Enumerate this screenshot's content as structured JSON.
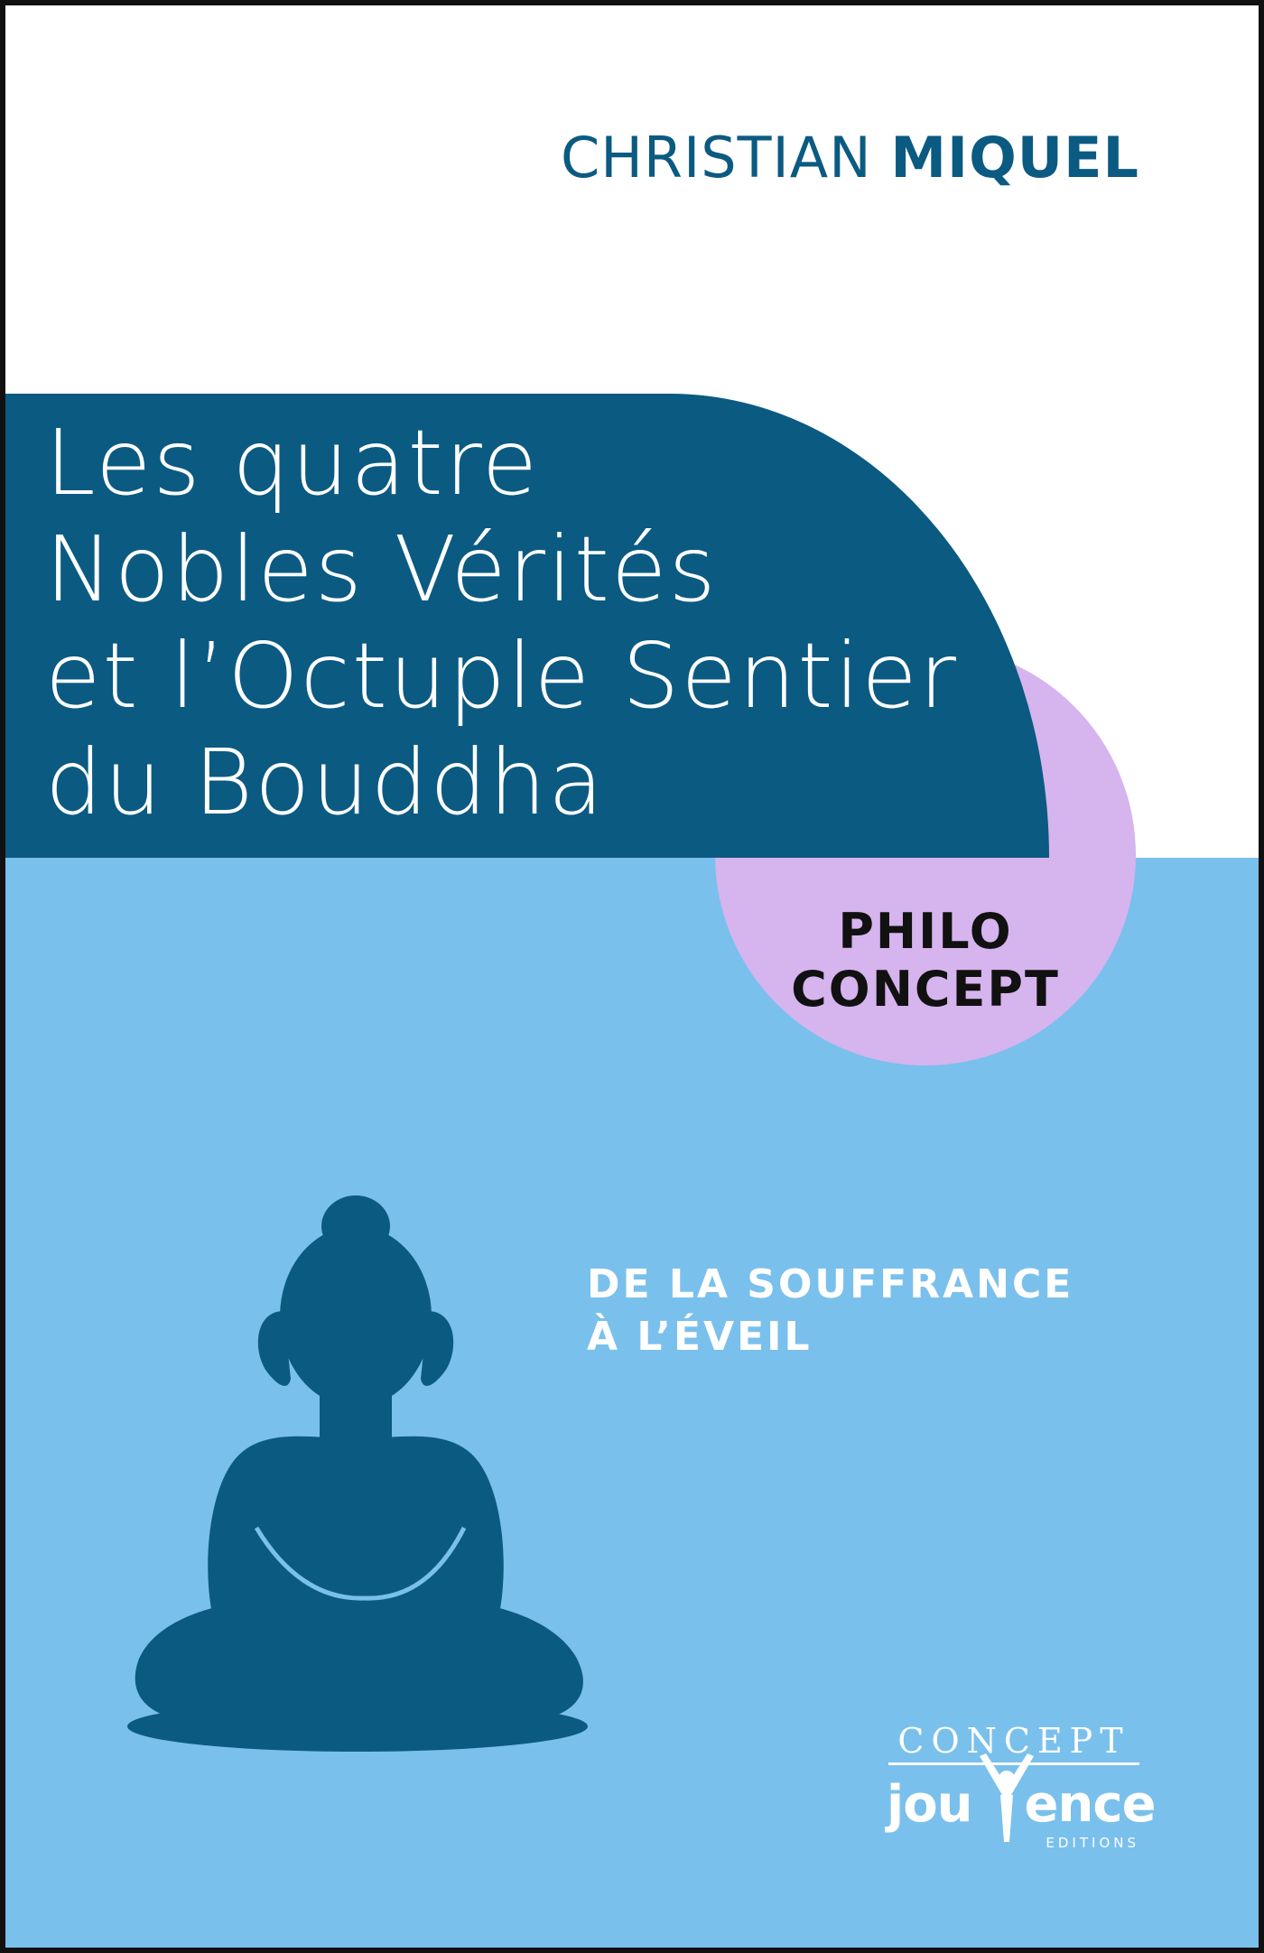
{
  "author": {
    "first_name": "CHRISTIAN",
    "last_name": "MIQUEL"
  },
  "title_lines": [
    "Les quatre",
    "Nobles Vérités",
    "et l’Octuple Sentier",
    "du Bouddha"
  ],
  "collection": {
    "line1": "PHILO",
    "line2": "CONCEPT"
  },
  "subtitle_lines": [
    "DE LA SOUFFRANCE",
    "À L’ÉVEIL"
  ],
  "publisher": {
    "series": "CONCEPT",
    "name_left": "jou",
    "name_right": "ence",
    "editions": "EDITIONS"
  },
  "illustration": {
    "subject": "buddha-silhouette-icon"
  },
  "colors": {
    "dark_blue": "#0b5a82",
    "light_blue": "#7ac0ec",
    "lavender": "#d6b4ee",
    "white": "#ffffff"
  }
}
